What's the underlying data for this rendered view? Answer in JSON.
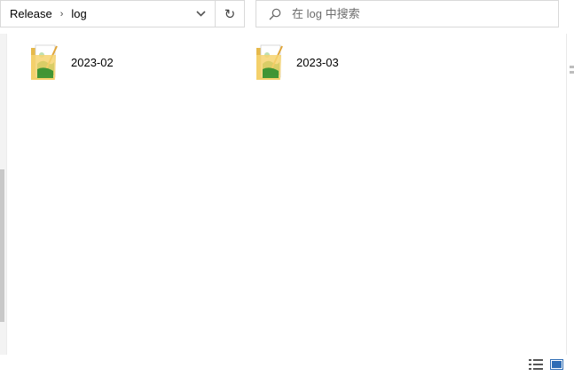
{
  "address": {
    "breadcrumbs": [
      "Release",
      "log"
    ],
    "separator": "›",
    "dropdown_icon": "chevron-down-icon",
    "refresh_glyph": "↻"
  },
  "search": {
    "placeholder": "在 log 中搜索",
    "value": ""
  },
  "items": [
    {
      "name": "2023-02",
      "icon": "folder-with-image-icon"
    },
    {
      "name": "2023-03",
      "icon": "folder-with-image-icon"
    }
  ],
  "statusbar": {
    "view_buttons": [
      "details-view-icon",
      "large-icons-view-icon"
    ]
  },
  "colors": {
    "border": "#d9d9d9",
    "folder": "#f6d470",
    "folder_dark": "#e6b94a",
    "accent_green": "#3aa63a",
    "view_active": "#2f6db5"
  }
}
